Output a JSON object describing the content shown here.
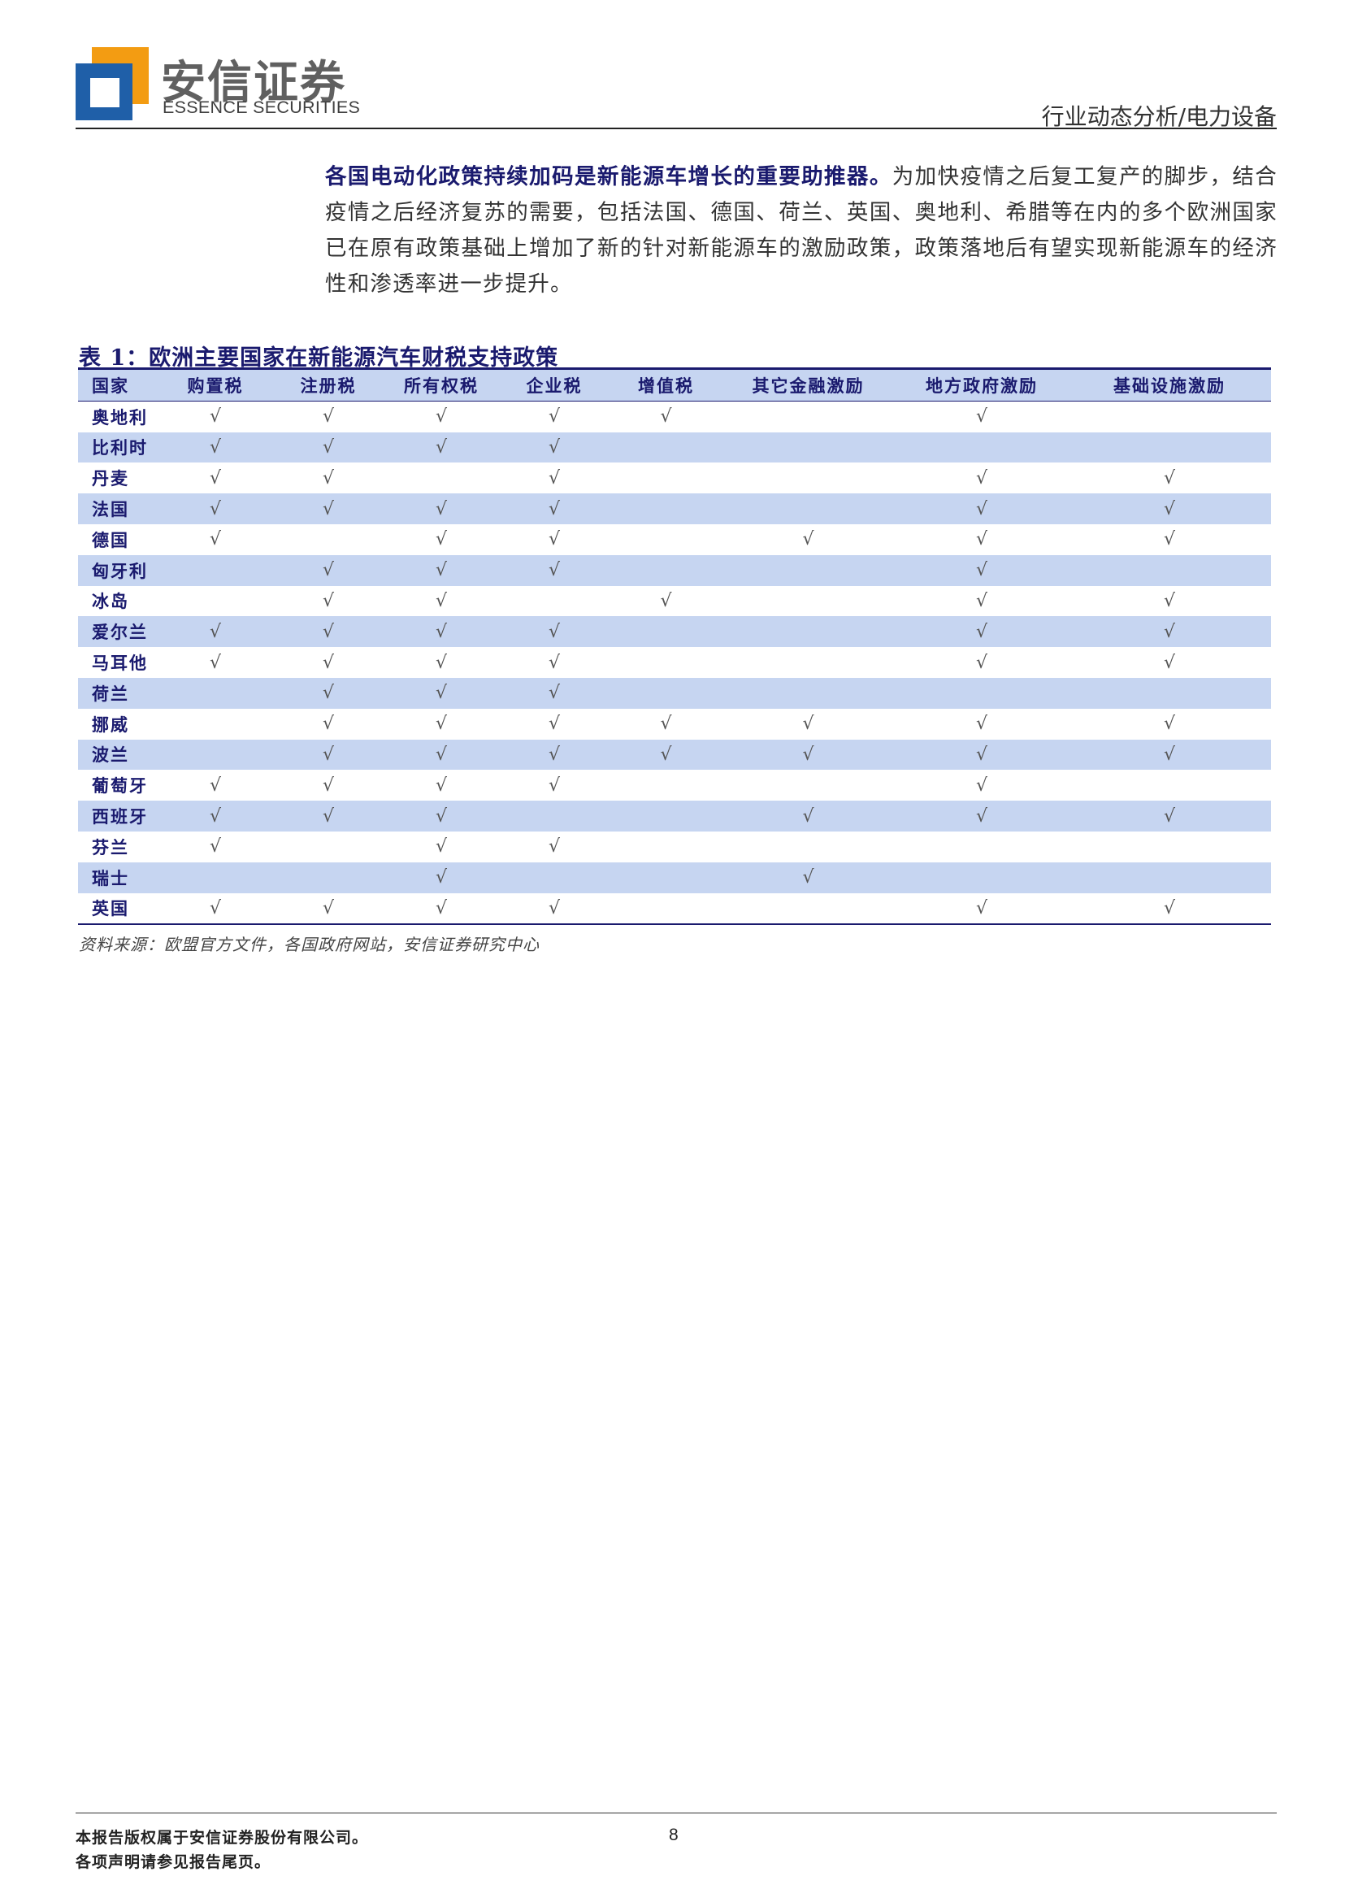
{
  "header": {
    "brand_cn": "安信证券",
    "brand_en": "ESSENCE SECURITIES",
    "category": "行业动态分析/电力设备"
  },
  "intro": {
    "bold": "各国电动化政策持续加码是新能源车增长的重要助推器。",
    "text": "为加快疫情之后复工复产的脚步，结合疫情之后经济复苏的需要，包括法国、德国、荷兰、英国、奥地利、希腊等在内的多个欧洲国家已在原有政策基础上增加了新的针对新能源车的激励政策，政策落地后有望实现新能源车的经济性和渗透率进一步提升。"
  },
  "table": {
    "caption": "表 1：欧洲主要国家在新能源汽车财税支持政策",
    "headers": [
      "国家",
      "购置税",
      "注册税",
      "所有权税",
      "企业税",
      "增值税",
      "其它金融激励",
      "地方政府激励",
      "基础设施激励"
    ],
    "rows": [
      [
        "奥地利",
        "√",
        "√",
        "√",
        "√",
        "√",
        "",
        "√",
        ""
      ],
      [
        "比利时",
        "√",
        "√",
        "√",
        "√",
        "",
        "",
        "",
        ""
      ],
      [
        "丹麦",
        "√",
        "√",
        "",
        "√",
        "",
        "",
        "√",
        "√"
      ],
      [
        "法国",
        "√",
        "√",
        "√",
        "√",
        "",
        "",
        "√",
        "√"
      ],
      [
        "德国",
        "√",
        "",
        "√",
        "√",
        "",
        "√",
        "√",
        "√"
      ],
      [
        "匈牙利",
        "",
        "√",
        "√",
        "√",
        "",
        "",
        "√",
        ""
      ],
      [
        "冰岛",
        "",
        "√",
        "√",
        "",
        "√",
        "",
        "√",
        "√"
      ],
      [
        "爱尔兰",
        "√",
        "√",
        "√",
        "√",
        "",
        "",
        "√",
        "√"
      ],
      [
        "马耳他",
        "√",
        "√",
        "√",
        "√",
        "",
        "",
        "√",
        "√"
      ],
      [
        "荷兰",
        "",
        "√",
        "√",
        "√",
        "",
        "",
        "",
        ""
      ],
      [
        "挪威",
        "",
        "√",
        "√",
        "√",
        "√",
        "√",
        "√",
        "√"
      ],
      [
        "波兰",
        "",
        "√",
        "√",
        "√",
        "√",
        "√",
        "√",
        "√"
      ],
      [
        "葡萄牙",
        "√",
        "√",
        "√",
        "√",
        "",
        "",
        "√",
        ""
      ],
      [
        "西班牙",
        "√",
        "√",
        "√",
        "",
        "",
        "√",
        "√",
        "√"
      ],
      [
        "芬兰",
        "√",
        "",
        "√",
        "√",
        "",
        "",
        "",
        ""
      ],
      [
        "瑞士",
        "",
        "",
        "√",
        "",
        "",
        "√",
        "",
        ""
      ],
      [
        "英国",
        "√",
        "√",
        "√",
        "√",
        "",
        "",
        "√",
        "√"
      ]
    ],
    "source": "资料来源：欧盟官方文件，各国政府网站，安信证券研究中心"
  },
  "footer": {
    "line1": "本报告版权属于安信证券股份有限公司。",
    "line2": "各项声明请参见报告尾页。",
    "page": "8"
  },
  "colors": {
    "brand_orange": "#f39c12",
    "brand_blue": "#1f5fa8",
    "table_band": "#c6d5f1",
    "heading_navy": "#1a1a6e"
  }
}
